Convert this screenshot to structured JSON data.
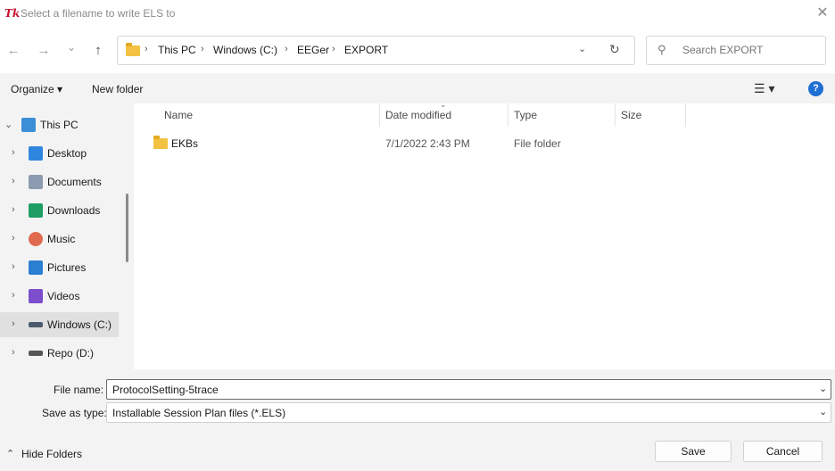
{
  "window": {
    "title": "Select a filename to write ELS to",
    "app_icon_text": "Tk",
    "close_glyph": "✕"
  },
  "nav": {
    "back_glyph": "←",
    "forward_glyph": "→",
    "recent_glyph": "⌄",
    "up_glyph": "↑",
    "breadcrumb": [
      "This PC",
      "Windows (C:)",
      "EEGer",
      "EXPORT"
    ],
    "separator": "›",
    "dropdown_glyph": "⌄",
    "refresh_glyph": "↻",
    "search_placeholder": "Search EXPORT",
    "search_glyph": "⚲"
  },
  "toolbar": {
    "organize_label": "Organize ▾",
    "new_folder_label": "New folder",
    "view_glyph": "☰ ▾",
    "help_glyph": "?"
  },
  "sidebar": {
    "items": [
      {
        "label": "This PC",
        "chev": "⌄",
        "icon": "monitor-icon",
        "color": "#3a8fd6"
      },
      {
        "label": "Desktop",
        "chev": "›",
        "icon": "desktop-icon",
        "color": "#2e86de"
      },
      {
        "label": "Documents",
        "chev": "›",
        "icon": "documents-icon",
        "color": "#8c9bb0"
      },
      {
        "label": "Downloads",
        "chev": "›",
        "icon": "downloads-icon",
        "color": "#1f9e63"
      },
      {
        "label": "Music",
        "chev": "›",
        "icon": "music-icon",
        "color": "#e06a4e"
      },
      {
        "label": "Pictures",
        "chev": "›",
        "icon": "pictures-icon",
        "color": "#2b7fd1"
      },
      {
        "label": "Videos",
        "chev": "›",
        "icon": "videos-icon",
        "color": "#7c4dcc"
      },
      {
        "label": "Windows (C:)",
        "chev": "›",
        "icon": "drive-c-icon",
        "color": "#4a5a6a"
      },
      {
        "label": "Repo (D:)",
        "chev": "›",
        "icon": "drive-d-icon",
        "color": "#555555"
      }
    ],
    "selected_index": 7
  },
  "file_list": {
    "columns": [
      "Name",
      "Date modified",
      "Type",
      "Size"
    ],
    "sort_glyph": "⌄",
    "rows": [
      {
        "name": "EKBs",
        "date": "7/1/2022 2:43 PM",
        "type": "File folder",
        "size": ""
      }
    ]
  },
  "form": {
    "file_name_label": "File name:",
    "file_name_value": "ProtocolSetting-5trace",
    "save_type_label": "Save as type:",
    "save_type_value": "Installable Session Plan files (*.ELS)",
    "combo_glyph": "⌄"
  },
  "footer": {
    "hide_folders_label": "Hide Folders",
    "hide_glyph": "⌃",
    "save_label": "Save",
    "cancel_label": "Cancel"
  },
  "colors": {
    "accent": "#1f6ed4",
    "folder": "#f4c242"
  }
}
